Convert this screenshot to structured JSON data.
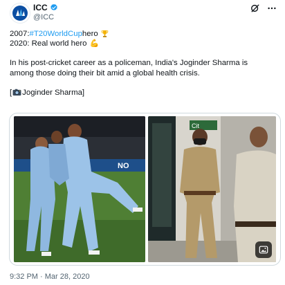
{
  "author": {
    "display_name": "ICC",
    "handle": "@ICC",
    "avatar_icon": "icc-logo-icon",
    "verified_icon": "verified-badge-icon",
    "verified_color": "#1d9bf0"
  },
  "toolbar": {
    "grok_icon": "grok-icon",
    "more_icon": "more-options-icon"
  },
  "tweet": {
    "line1_prefix": "2007: ",
    "line1_hashtag": "#T20WorldCup",
    "line1_suffix": " hero",
    "line1_emoji": "trophy-emoji",
    "line2_text": "2020: Real world hero",
    "line2_emoji": "💪",
    "para1": "In his post-cricket career as a policeman, India's Joginder Sharma is",
    "para2": "among those doing their bit amid a global health crisis.",
    "photo_credit_open": "[",
    "photo_credit_icon": "camera-emoji",
    "photo_credit_name": " Joginder Sharma]",
    "hashtag_color": "#1d9bf0"
  },
  "media": {
    "left_photo": "cricket-celebration-photo",
    "right_photo": "policeman-photo",
    "alt_button_icon": "image-description-icon"
  },
  "footer": {
    "timestamp": "9:32 PM · Mar 28, 2020"
  }
}
